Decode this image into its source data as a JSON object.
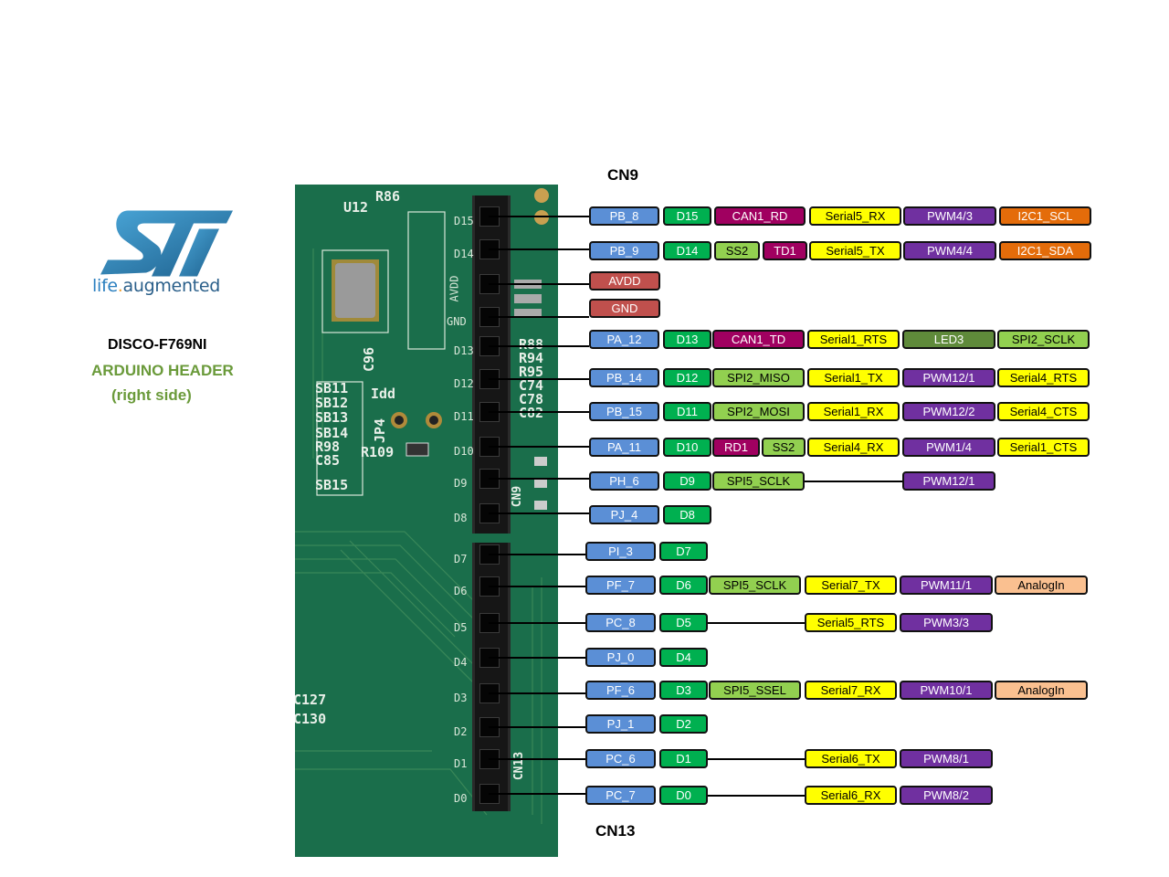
{
  "brand": {
    "logo_name": "ST",
    "tagline_part1": "life",
    "tagline_dot": ".",
    "tagline_part2": "augmented"
  },
  "board": {
    "name": "DISCO-F769NI",
    "title": "ARDUINO HEADER",
    "subtitle": "(right side)"
  },
  "connectors": {
    "top": "CN9",
    "bottom": "CN13"
  },
  "pcb_silkscreen": [
    "U12",
    "R86",
    "SB11",
    "SB12",
    "SB13",
    "SB14",
    "R98",
    "C85",
    "SB15",
    "Idd",
    "JP4",
    "R109",
    "C96",
    "R88",
    "R94",
    "R95",
    "C74",
    "C78",
    "C82",
    "C127",
    "C130",
    "CN9",
    "CN13"
  ],
  "pcb_pin_labels": [
    "D15",
    "D14",
    "AVDD",
    "GND",
    "D13",
    "D12",
    "D11",
    "D10",
    "D9",
    "D8",
    "D7",
    "D6",
    "D5",
    "D4",
    "D3",
    "D2",
    "D1",
    "D0"
  ],
  "legend_colors": {
    "pin": "#5b8fd6",
    "arduino": "#00b050",
    "can": "#a00060",
    "serial": "#ffff00",
    "pwm": "#7030a0",
    "i2c": "#e46c0a",
    "spi": "#92d050",
    "led": "#5f8a3a",
    "power": "#c0504d",
    "analog": "#fac090"
  },
  "pins": [
    {
      "pin": "PB_8",
      "arduino": "D15",
      "functions": [
        {
          "label": "CAN1_RD",
          "type": "can"
        },
        {
          "label": "Serial5_RX",
          "type": "ser"
        },
        {
          "label": "PWM4/3",
          "type": "pwm"
        },
        {
          "label": "I2C1_SCL",
          "type": "i2c"
        }
      ]
    },
    {
      "pin": "PB_9",
      "arduino": "D14",
      "functions": [
        {
          "label": "SS2",
          "type": "spi"
        },
        {
          "label": "TD1",
          "type": "can"
        },
        {
          "label": "Serial5_TX",
          "type": "ser"
        },
        {
          "label": "PWM4/4",
          "type": "pwm"
        },
        {
          "label": "I2C1_SDA",
          "type": "i2c"
        }
      ]
    },
    {
      "pin": "AVDD",
      "type": "power"
    },
    {
      "pin": "GND",
      "type": "power"
    },
    {
      "pin": "PA_12",
      "arduino": "D13",
      "functions": [
        {
          "label": "CAN1_TD",
          "type": "can"
        },
        {
          "label": "Serial1_RTS",
          "type": "ser"
        },
        {
          "label": "LED3",
          "type": "led"
        },
        {
          "label": "SPI2_SCLK",
          "type": "spi"
        }
      ]
    },
    {
      "pin": "PB_14",
      "arduino": "D12",
      "functions": [
        {
          "label": "SPI2_MISO",
          "type": "spi"
        },
        {
          "label": "Serial1_TX",
          "type": "ser"
        },
        {
          "label": "PWM12/1",
          "type": "pwm"
        },
        {
          "label": "Serial4_RTS",
          "type": "ser"
        }
      ]
    },
    {
      "pin": "PB_15",
      "arduino": "D11",
      "functions": [
        {
          "label": "SPI2_MOSI",
          "type": "spi"
        },
        {
          "label": "Serial1_RX",
          "type": "ser"
        },
        {
          "label": "PWM12/2",
          "type": "pwm"
        },
        {
          "label": "Serial4_CTS",
          "type": "ser"
        }
      ]
    },
    {
      "pin": "PA_11",
      "arduino": "D10",
      "functions": [
        {
          "label": "RD1",
          "type": "can"
        },
        {
          "label": "SS2",
          "type": "spi"
        },
        {
          "label": "Serial4_RX",
          "type": "ser"
        },
        {
          "label": "PWM1/4",
          "type": "pwm"
        },
        {
          "label": "Serial1_CTS",
          "type": "ser"
        }
      ]
    },
    {
      "pin": "PH_6",
      "arduino": "D9",
      "functions": [
        {
          "label": "SPI5_SCLK",
          "type": "spi"
        },
        {
          "label": "",
          "type": "gap"
        },
        {
          "label": "PWM12/1",
          "type": "pwm"
        }
      ]
    },
    {
      "pin": "PJ_4",
      "arduino": "D8",
      "functions": []
    },
    {
      "pin": "PI_3",
      "arduino": "D7",
      "functions": []
    },
    {
      "pin": "PF_7",
      "arduino": "D6",
      "functions": [
        {
          "label": "SPI5_SCLK",
          "type": "spi"
        },
        {
          "label": "Serial7_TX",
          "type": "ser"
        },
        {
          "label": "PWM11/1",
          "type": "pwm"
        },
        {
          "label": "AnalogIn",
          "type": "ana"
        }
      ]
    },
    {
      "pin": "PC_8",
      "arduino": "D5",
      "functions": [
        {
          "label": "",
          "type": "gap"
        },
        {
          "label": "Serial5_RTS",
          "type": "ser"
        },
        {
          "label": "PWM3/3",
          "type": "pwm"
        }
      ]
    },
    {
      "pin": "PJ_0",
      "arduino": "D4",
      "functions": []
    },
    {
      "pin": "PF_6",
      "arduino": "D3",
      "functions": [
        {
          "label": "SPI5_SSEL",
          "type": "spi"
        },
        {
          "label": "Serial7_RX",
          "type": "ser"
        },
        {
          "label": "PWM10/1",
          "type": "pwm"
        },
        {
          "label": "AnalogIn",
          "type": "ana"
        }
      ]
    },
    {
      "pin": "PJ_1",
      "arduino": "D2",
      "functions": []
    },
    {
      "pin": "PC_6",
      "arduino": "D1",
      "functions": [
        {
          "label": "",
          "type": "gap"
        },
        {
          "label": "Serial6_TX",
          "type": "ser"
        },
        {
          "label": "PWM8/1",
          "type": "pwm"
        }
      ]
    },
    {
      "pin": "PC_7",
      "arduino": "D0",
      "functions": [
        {
          "label": "",
          "type": "gap"
        },
        {
          "label": "Serial6_RX",
          "type": "ser"
        },
        {
          "label": "PWM8/2",
          "type": "pwm"
        }
      ]
    }
  ]
}
